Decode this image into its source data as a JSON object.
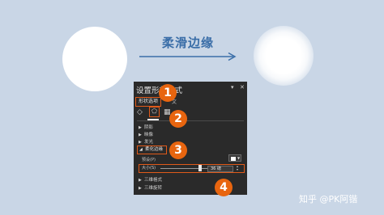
{
  "title": "柔滑边缘",
  "panel": {
    "title": "设置形状格式",
    "controls": {
      "dropdown": "▾",
      "close": "✕"
    },
    "tabs": {
      "shape_options": "形状选项",
      "text_options": "文"
    },
    "icons": {
      "fill_line": "fill-line-icon",
      "effects": "effects-pentagon-icon",
      "size_properties": "size-properties-icon"
    },
    "sections": [
      "阴影",
      "映像",
      "发光",
      "柔化边缘",
      "三维格式",
      "三维旋转"
    ],
    "soft_edge": {
      "preset_label": "预设(P)",
      "size_label": "大小(S)",
      "size_value": "36 磅",
      "slider_fraction": 0.82
    }
  },
  "badges": [
    "1",
    "2",
    "3",
    "4"
  ],
  "watermark": "知乎 @PK阿锴",
  "colors": {
    "accent": "#e8650f",
    "title": "#3a6ea8",
    "background": "#c9d6e6",
    "panel": "#2a2a2a"
  }
}
